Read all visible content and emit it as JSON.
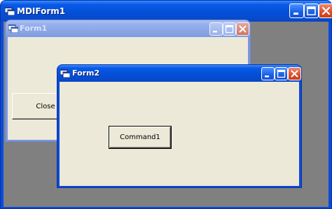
{
  "mdi_window": {
    "title": "MDIForm1",
    "colors": {
      "frame": "#0a4bd8",
      "client": "#808080"
    }
  },
  "form1": {
    "title": "Form1",
    "close_button_label": "Close",
    "state": "inactive"
  },
  "form2": {
    "title": "Form2",
    "command_button_label": "Command1",
    "state": "active"
  },
  "icons": {
    "app": "vb-form-icon",
    "minimize": "minimize-icon",
    "maximize": "maximize-icon",
    "close": "close-icon"
  }
}
